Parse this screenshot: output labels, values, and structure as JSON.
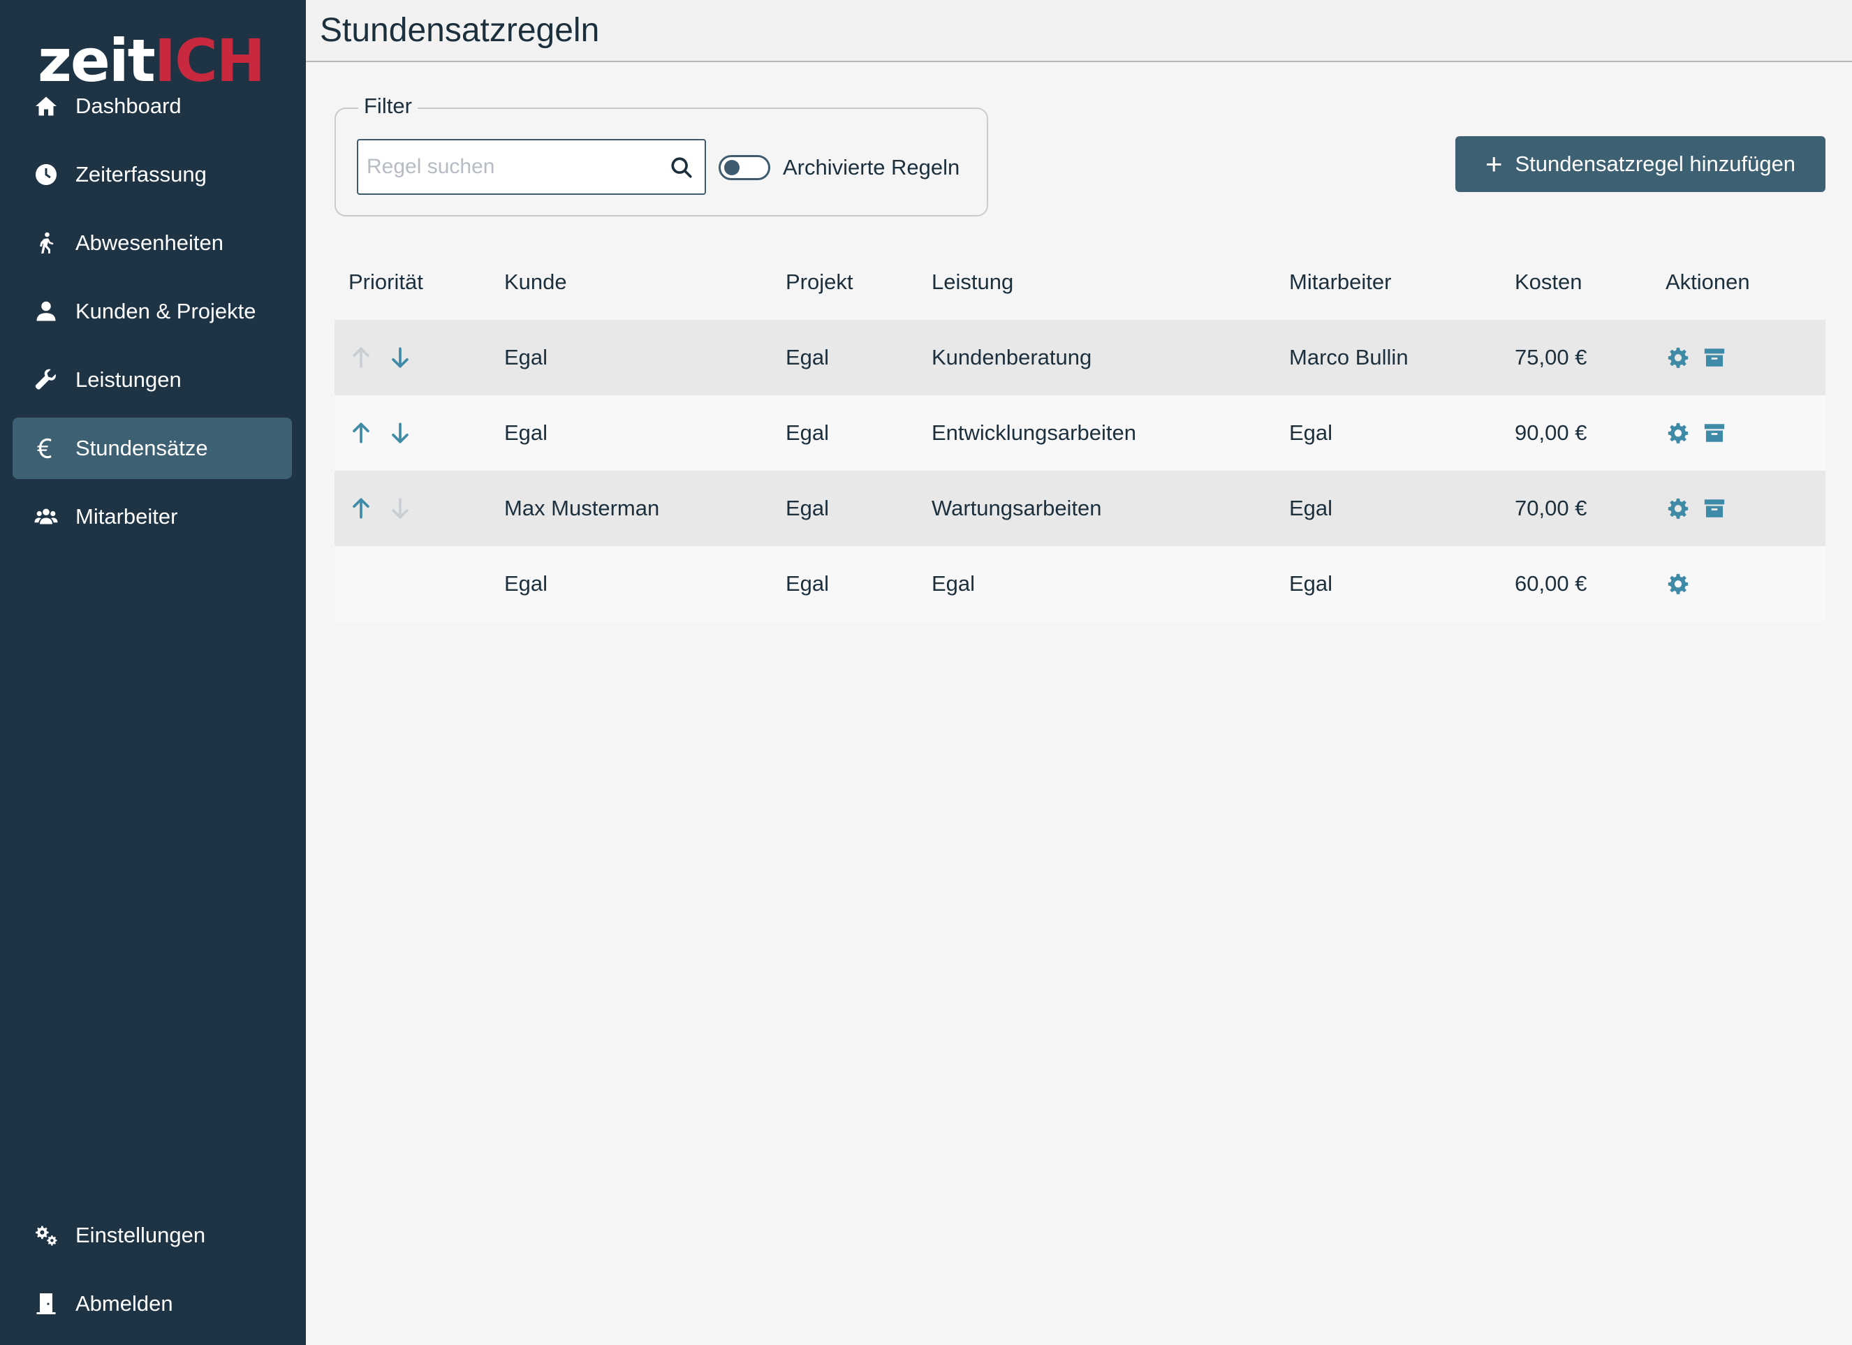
{
  "app": {
    "logo_text": "zeit",
    "logo_accent": "ICH",
    "accent_color": "#c8293f",
    "brand_color": "#3d6173",
    "sidebar_color": "#1e3344"
  },
  "sidebar": {
    "items": [
      {
        "label": "Dashboard",
        "icon": "home-icon"
      },
      {
        "label": "Zeiterfassung",
        "icon": "clock-icon"
      },
      {
        "label": "Abwesenheiten",
        "icon": "walking-icon"
      },
      {
        "label": "Kunden & Projekte",
        "icon": "user-icon"
      },
      {
        "label": "Leistungen",
        "icon": "wrench-icon"
      },
      {
        "label": "Stundensätze",
        "icon": "euro-icon",
        "active": true
      },
      {
        "label": "Mitarbeiter",
        "icon": "users-icon"
      }
    ],
    "bottom_items": [
      {
        "label": "Einstellungen",
        "icon": "gears-icon"
      },
      {
        "label": "Abmelden",
        "icon": "door-icon"
      }
    ]
  },
  "header": {
    "title": "Stundensatzregeln"
  },
  "filter": {
    "legend": "Filter",
    "search_placeholder": "Regel suchen",
    "search_value": "",
    "toggle_label": "Archivierte Regeln",
    "toggle_on": false
  },
  "add_button": {
    "label": "Stundensatzregel hinzufügen"
  },
  "table": {
    "columns": [
      "Priorität",
      "Kunde",
      "Projekt",
      "Leistung",
      "Mitarbeiter",
      "Kosten",
      "Aktionen"
    ],
    "rows": [
      {
        "up_enabled": false,
        "down_enabled": true,
        "kunde": "Egal",
        "projekt": "Egal",
        "leistung": "Kundenberatung",
        "mitarbeiter": "Marco Bullin",
        "kosten": "75,00 €",
        "actions": [
          "gear-icon",
          "archive-icon"
        ]
      },
      {
        "up_enabled": true,
        "down_enabled": true,
        "kunde": "Egal",
        "projekt": "Egal",
        "leistung": "Entwicklungsarbeiten",
        "mitarbeiter": "Egal",
        "kosten": "90,00 €",
        "actions": [
          "gear-icon",
          "archive-icon"
        ]
      },
      {
        "up_enabled": true,
        "down_enabled": false,
        "kunde": "Max Musterman",
        "projekt": "Egal",
        "leistung": "Wartungsarbeiten",
        "mitarbeiter": "Egal",
        "kosten": "70,00 €",
        "actions": [
          "gear-icon",
          "archive-icon"
        ]
      },
      {
        "up_enabled": null,
        "down_enabled": null,
        "kunde": "Egal",
        "projekt": "Egal",
        "leistung": "Egal",
        "mitarbeiter": "Egal",
        "kosten": "60,00 €",
        "actions": [
          "gear-icon"
        ]
      }
    ]
  }
}
